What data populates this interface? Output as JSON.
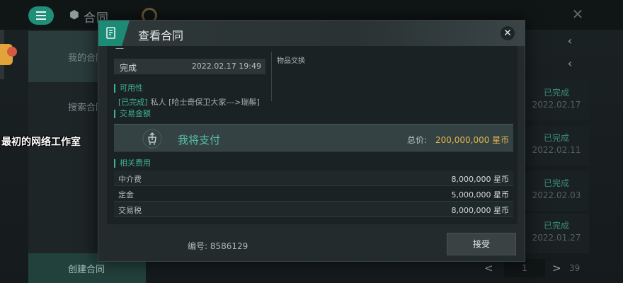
{
  "background": {
    "title": "合同",
    "sidebar": {
      "items": [
        "我的合同",
        "搜索合同"
      ],
      "create_label": "创建合同"
    },
    "list": [
      {
        "status": "已完成",
        "date": "2022.02.17"
      },
      {
        "status": "已完成",
        "date": "2022.02.11"
      },
      {
        "status": "已完成",
        "date": "2022.02.03"
      },
      {
        "status": "已完成",
        "date": "2022.01.27"
      }
    ],
    "pager": {
      "current": "1",
      "total": "39"
    }
  },
  "watermark": "最初的网络工作室",
  "dialog": {
    "title": "查看合同",
    "top_stub": "一",
    "status": "完成",
    "status_time": "2022.02.17 19:49",
    "trade_type": "物品交换",
    "availability": {
      "heading": "可用性",
      "status_tag": "[已完成]",
      "detail": "私人 [哈士奇保卫大家--->瑞鬃]"
    },
    "amount_heading": "交易金额",
    "payment": {
      "text": "我将支付",
      "total_label": "总价:",
      "total_value": "200,000,000 星币"
    },
    "fees_heading": "相关费用",
    "fees": [
      {
        "name": "中介费",
        "value": "8,000,000 星币"
      },
      {
        "name": "定金",
        "value": "5,000,000 星币"
      },
      {
        "name": "交易税",
        "value": "8,000,000 星币"
      }
    ],
    "contract_id": "编号: 8586129",
    "accept_label": "接受"
  },
  "colors": {
    "accent": "#1d8a76",
    "accent_text": "#3fb398",
    "gold": "#e1b54c"
  }
}
